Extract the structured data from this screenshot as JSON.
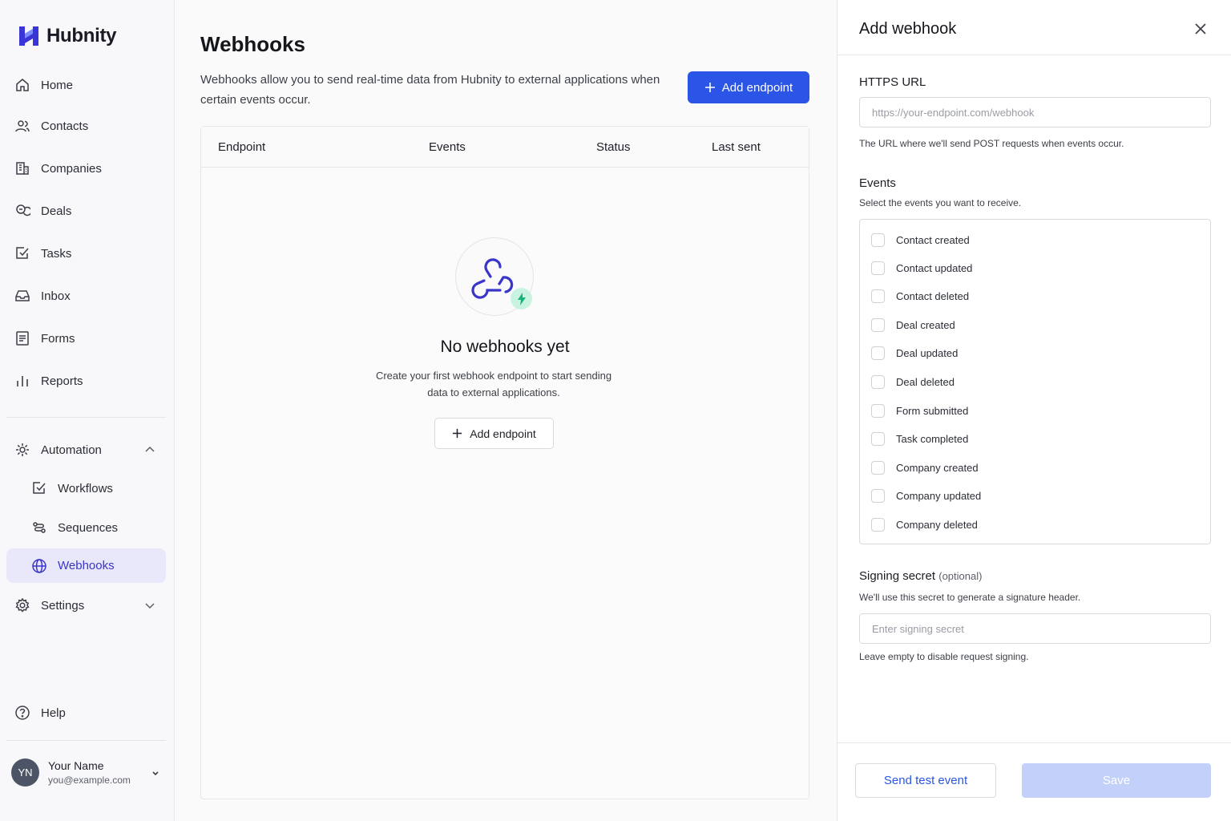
{
  "app": {
    "name": "Hubnity"
  },
  "sidebar": {
    "items": [
      {
        "label": "Home",
        "icon": "home-icon"
      },
      {
        "label": "Contacts",
        "icon": "users-icon"
      },
      {
        "label": "Companies",
        "icon": "building-icon"
      },
      {
        "label": "Deals",
        "icon": "coins-icon"
      },
      {
        "label": "Tasks",
        "icon": "checkbox-icon"
      },
      {
        "label": "Inbox",
        "icon": "inbox-icon"
      },
      {
        "label": "Forms",
        "icon": "form-icon"
      },
      {
        "label": "Reports",
        "icon": "bar-chart-icon"
      }
    ],
    "automation": {
      "label": "Automation",
      "expanded": true,
      "children": [
        {
          "label": "Workflows",
          "icon": "workflow-icon"
        },
        {
          "label": "Sequences",
          "icon": "sequence-icon"
        },
        {
          "label": "Webhooks",
          "icon": "globe-icon",
          "active": true
        }
      ]
    },
    "settings": {
      "label": "Settings"
    },
    "help": {
      "label": "Help"
    },
    "user": {
      "initials": "YN",
      "name": "Your Name",
      "email": "you@example.com"
    }
  },
  "main": {
    "title": "Webhooks",
    "description": "Webhooks allow you to send real-time data from Hubnity to external applications when certain events occur.",
    "add_button": "Add endpoint",
    "table": {
      "columns": [
        "Endpoint",
        "Events",
        "Status",
        "Last sent"
      ]
    },
    "empty": {
      "title": "No webhooks yet",
      "description": "Create your first webhook endpoint to start sending data to external applications.",
      "button": "Add endpoint"
    }
  },
  "panel": {
    "title": "Add webhook",
    "url": {
      "label": "HTTPS URL",
      "placeholder": "https://your-endpoint.com/webhook",
      "help": "The URL where we'll send POST requests when events occur."
    },
    "events": {
      "label": "Events",
      "help": "Select the events you want to receive.",
      "options": [
        "Contact created",
        "Contact updated",
        "Contact deleted",
        "Deal created",
        "Deal updated",
        "Deal deleted",
        "Form submitted",
        "Task completed",
        "Company created",
        "Company updated",
        "Company deleted"
      ]
    },
    "secret": {
      "label": "Signing secret",
      "optional": "(optional)",
      "help": "We'll use this secret to generate a signature header.",
      "placeholder": "Enter signing secret",
      "note": "Leave empty to disable request signing."
    },
    "footer": {
      "test_button": "Send test event",
      "save_button": "Save"
    }
  },
  "colors": {
    "primary": "#2b55e6",
    "active_bg": "#e9e8fb",
    "active_text": "#3a35c9",
    "badge": "#c9f3e1",
    "bolt": "#19b27a",
    "save_disabled": "#c3d1fa"
  }
}
